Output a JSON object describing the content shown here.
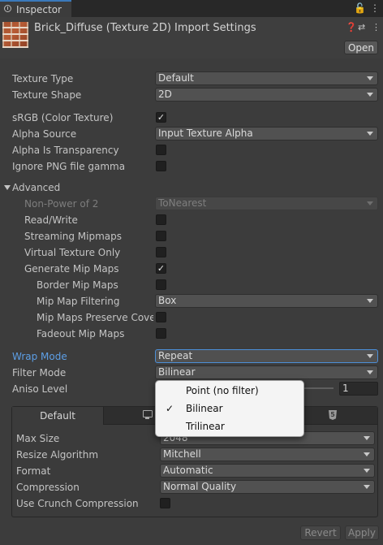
{
  "tab": {
    "label": "Inspector"
  },
  "header": {
    "title": "Brick_Diffuse (Texture 2D) Import Settings",
    "open_label": "Open"
  },
  "rows": {
    "texture_type": {
      "label": "Texture Type",
      "value": "Default"
    },
    "texture_shape": {
      "label": "Texture Shape",
      "value": "2D"
    },
    "srgb": {
      "label": "sRGB (Color Texture)",
      "checked": true
    },
    "alpha_source": {
      "label": "Alpha Source",
      "value": "Input Texture Alpha"
    },
    "alpha_is_transparency": {
      "label": "Alpha Is Transparency",
      "checked": false
    },
    "ignore_png_gamma": {
      "label": "Ignore PNG file gamma",
      "checked": false
    }
  },
  "advanced": {
    "label": "Advanced",
    "non_power_of_2": {
      "label": "Non-Power of 2",
      "value": "ToNearest"
    },
    "read_write": {
      "label": "Read/Write",
      "checked": false
    },
    "streaming_mipmaps": {
      "label": "Streaming Mipmaps",
      "checked": false
    },
    "virtual_texture_only": {
      "label": "Virtual Texture Only",
      "checked": false
    },
    "generate_mip_maps": {
      "label": "Generate Mip Maps",
      "checked": true
    },
    "border_mip_maps": {
      "label": "Border Mip Maps",
      "checked": false
    },
    "mip_map_filtering": {
      "label": "Mip Map Filtering",
      "value": "Box"
    },
    "mip_maps_preserve_coverage": {
      "label": "Mip Maps Preserve Cover",
      "checked": false
    },
    "fadeout_mip_maps": {
      "label": "Fadeout Mip Maps",
      "checked": false
    }
  },
  "wrap_mode": {
    "label": "Wrap Mode",
    "value": "Repeat"
  },
  "filter_mode": {
    "label": "Filter Mode",
    "value": "Bilinear"
  },
  "aniso_level": {
    "label": "Aniso Level",
    "value": "1"
  },
  "filter_menu": {
    "options": [
      "Point (no filter)",
      "Bilinear",
      "Trilinear"
    ],
    "selected": "Bilinear"
  },
  "platform": {
    "tabs": [
      "Default"
    ],
    "max_size": {
      "label": "Max Size",
      "value": "2048"
    },
    "resize_algorithm": {
      "label": "Resize Algorithm",
      "value": "Mitchell"
    },
    "format": {
      "label": "Format",
      "value": "Automatic"
    },
    "compression": {
      "label": "Compression",
      "value": "Normal Quality"
    },
    "use_crunch": {
      "label": "Use Crunch Compression",
      "checked": false
    }
  },
  "footer": {
    "revert_label": "Revert",
    "apply_label": "Apply"
  },
  "icons": [
    "info-icon",
    "lock-icon",
    "menu-icon",
    "help-icon",
    "settings-sliders-icon",
    "more-icon",
    "monitor-icon",
    "html5-icon"
  ]
}
